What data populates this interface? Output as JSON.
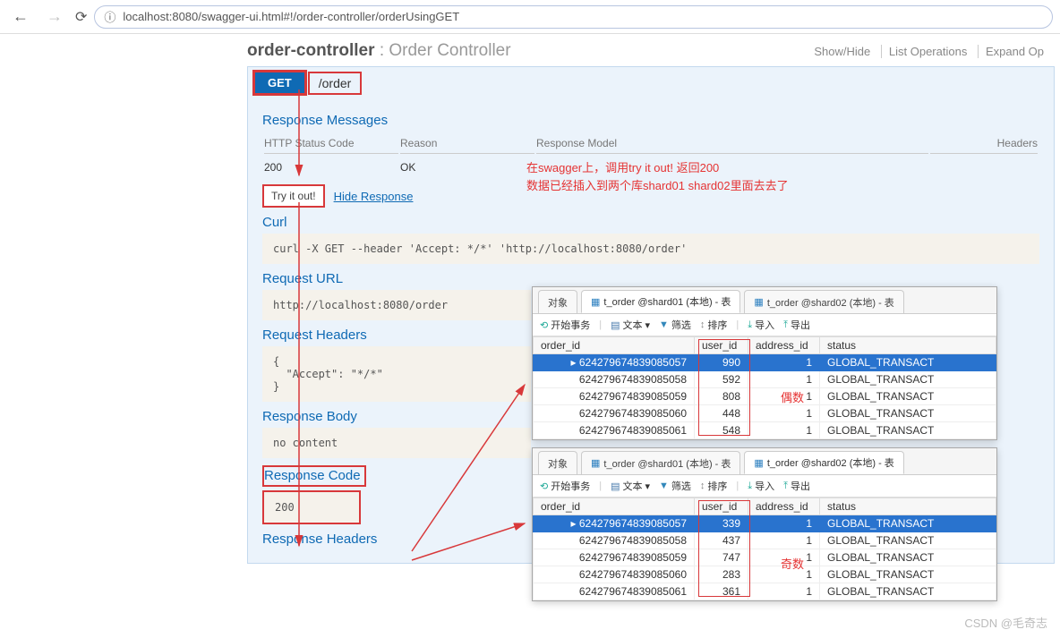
{
  "browser": {
    "url": "localhost:8080/swagger-ui.html#!/order-controller/orderUsingGET"
  },
  "controller": {
    "name": "order-controller",
    "sub": ": Order Controller",
    "ops": {
      "showhide": "Show/Hide",
      "list": "List Operations",
      "expand": "Expand Op"
    }
  },
  "op": {
    "method": "GET",
    "path": "/order"
  },
  "sections": {
    "responseMessages": "Response Messages",
    "curl": "Curl",
    "requestUrl": "Request URL",
    "requestHeaders": "Request Headers",
    "responseBody": "Response Body",
    "responseCode": "Response Code",
    "responseHeaders": "Response Headers"
  },
  "respTable": {
    "headers": {
      "code": "HTTP Status Code",
      "reason": "Reason",
      "model": "Response Model",
      "hdrs": "Headers"
    },
    "row": {
      "code": "200",
      "reason": "OK"
    }
  },
  "buttons": {
    "tryItOut": "Try it out!",
    "hideResponse": "Hide Response"
  },
  "code": {
    "curl": "curl -X GET --header 'Accept: */*' 'http://localhost:8080/order'",
    "requestUrl": "http://localhost:8080/order",
    "requestHeaders": "{\n  \"Accept\": \"*/*\"\n}",
    "responseBody": "no content",
    "responseCode": "200"
  },
  "annotations": {
    "line1": "在swagger上，调用try it out! 返回200",
    "line2": "数据已经插入到两个库shard01 shard02里面去去了",
    "even": "偶数",
    "odd": "奇数",
    "watermark": "CSDN @毛奇志"
  },
  "db1": {
    "tabObj": "对象",
    "tab1": "t_order @shard01 (本地) - 表",
    "tab2": "t_order @shard02 (本地) - 表",
    "toolbar": {
      "begin": "开始事务",
      "text": "文本",
      "filter": "筛选",
      "sort": "排序",
      "import": "导入",
      "export": "导出"
    },
    "cols": {
      "order_id": "order_id",
      "user_id": "user_id",
      "address_id": "address_id",
      "status": "status"
    },
    "rows": [
      {
        "order_id": "624279674839085057",
        "user_id": "990",
        "address_id": "1",
        "status": "GLOBAL_TRANSACT"
      },
      {
        "order_id": "624279674839085058",
        "user_id": "592",
        "address_id": "1",
        "status": "GLOBAL_TRANSACT"
      },
      {
        "order_id": "624279674839085059",
        "user_id": "808",
        "address_id": "1",
        "status": "GLOBAL_TRANSACT"
      },
      {
        "order_id": "624279674839085060",
        "user_id": "448",
        "address_id": "1",
        "status": "GLOBAL_TRANSACT"
      },
      {
        "order_id": "624279674839085061",
        "user_id": "548",
        "address_id": "1",
        "status": "GLOBAL_TRANSACT"
      }
    ]
  },
  "db2": {
    "tabObj": "对象",
    "tab1": "t_order @shard01 (本地) - 表",
    "tab2": "t_order @shard02 (本地) - 表",
    "toolbar": {
      "begin": "开始事务",
      "text": "文本",
      "filter": "筛选",
      "sort": "排序",
      "import": "导入",
      "export": "导出"
    },
    "cols": {
      "order_id": "order_id",
      "user_id": "user_id",
      "address_id": "address_id",
      "status": "status"
    },
    "rows": [
      {
        "order_id": "624279674839085057",
        "user_id": "339",
        "address_id": "1",
        "status": "GLOBAL_TRANSACT"
      },
      {
        "order_id": "624279674839085058",
        "user_id": "437",
        "address_id": "1",
        "status": "GLOBAL_TRANSACT"
      },
      {
        "order_id": "624279674839085059",
        "user_id": "747",
        "address_id": "1",
        "status": "GLOBAL_TRANSACT"
      },
      {
        "order_id": "624279674839085060",
        "user_id": "283",
        "address_id": "1",
        "status": "GLOBAL_TRANSACT"
      },
      {
        "order_id": "624279674839085061",
        "user_id": "361",
        "address_id": "1",
        "status": "GLOBAL_TRANSACT"
      }
    ]
  }
}
